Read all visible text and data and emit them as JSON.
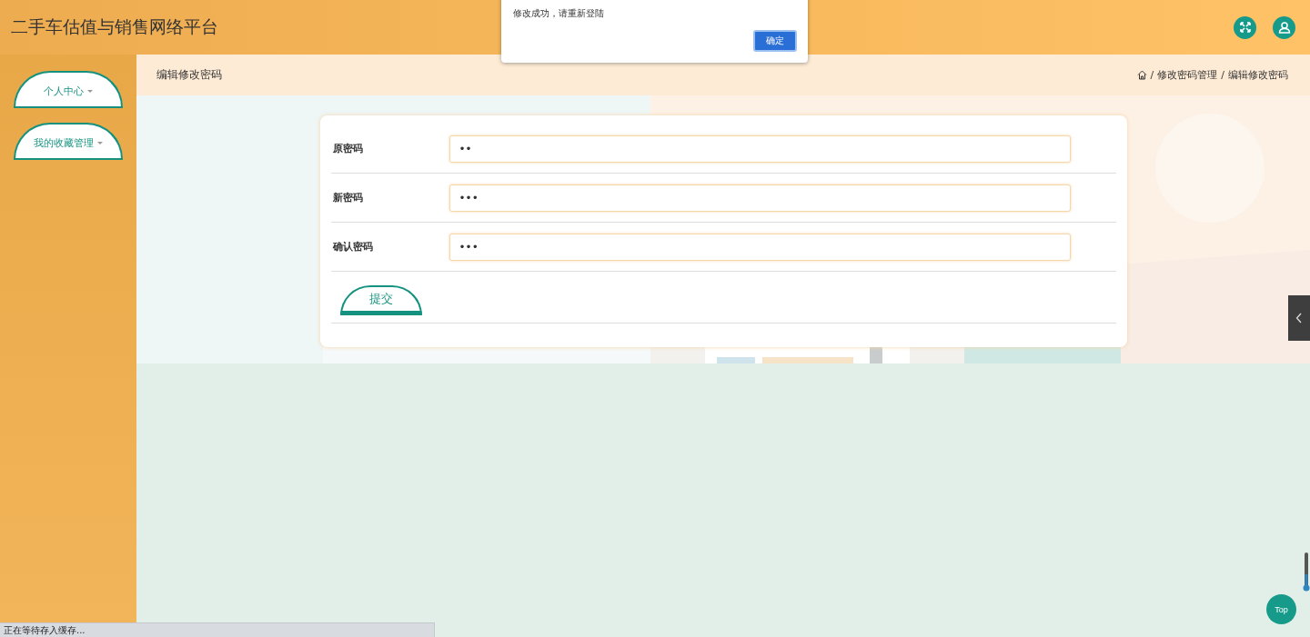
{
  "header": {
    "title": "二手车估值与销售网络平台"
  },
  "sidebar": {
    "items": [
      {
        "label": "个人中心",
        "expanded": false
      },
      {
        "label": "我的收藏管理",
        "expanded": false
      }
    ]
  },
  "page_title": "编辑修改密码",
  "breadcrumb": [
    "修改密码管理",
    "编辑修改密码"
  ],
  "breadcrumb_separator": "/",
  "form": {
    "fields": [
      {
        "label": "原密码",
        "value": "••"
      },
      {
        "label": "新密码",
        "value": "•••"
      },
      {
        "label": "确认密码",
        "value": "•••"
      }
    ],
    "submit": "提交"
  },
  "dialog": {
    "message": "修改成功，请重新登陆",
    "button": "确定"
  },
  "back_to_top": "Top",
  "status_bar": "正在等待存入缓存..."
}
